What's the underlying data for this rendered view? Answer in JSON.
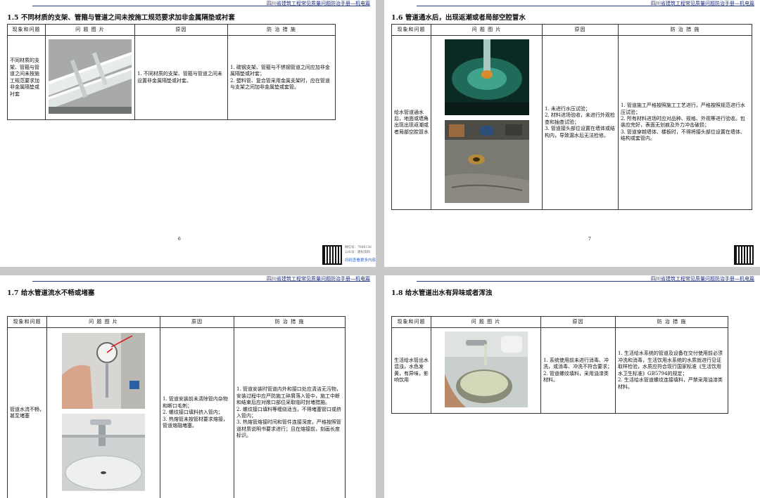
{
  "header": "四川省建筑工程常见质量问题防治手册—机电篇",
  "columns": [
    "现象和问题",
    "问 题 图 片",
    "原因",
    "防 治 措 施"
  ],
  "pages": [
    {
      "title": "1.5 不同材质的支架、管箍与管道之间未按施工规范要求加非金属隔垫或衬套",
      "phenomenon": "不同材质的支架、管箍与管道之间未按施工规范要求加非金属隔垫或衬套",
      "cause": "1. 不同材质的支架、管箍与管道之间未设置非金属隔垫或衬套。",
      "measures": "1. 碳钢支架、管箍与不锈钢管道之间应加非金属隔垫或衬套；\n2. 塑料管、复合管采用金属支架时，应在管道与支架之间加非金属垫或套管。",
      "page_no": "6",
      "qr_line1": "微信号：7886156",
      "qr_line2": "公众号：建标资料",
      "qr_link": "扫码查看更多内容"
    },
    {
      "title": "1.6 管道通水后，出现返潮或者局部空腔冒水",
      "phenomenon": "给水管道通水后，地面或墙角出现出现返潮或者局部空腔冒水",
      "cause": "1. 未进行水压试验；\n2. 材料进场验收，未进行外观检查和抽查试验；\n3. 管道接头部位设置在墙体或结构内，导致漏水后无法检修。",
      "measures": "1. 管道施工严格按照施工工艺进行，严格按照规范进行水压试验；\n2. 所有材料进场时应对品种、规格、外观等进行验收。包装应完好，表面无划痕及外力冲击破损；\n3. 管道穿越墙体、楼板时，不得将接头部位设置在墙体、结构或套管内。",
      "page_no": "7"
    },
    {
      "title": "1.7 给水管道流水不畅或堵塞",
      "phenomenon": "管道水流不畅，甚至堵塞",
      "cause": "1. 管道安装前未清除管内杂物和断口毛刺；\n2. 螺纹接口填料挤入管内；\n3. 热熔管未按管材要求熔接，管道熔融堵塞。",
      "measures": "1. 管道安装时管道内外和接口处应清洁无污物，安装过程中应严防施工碎屑落入管中，施工中断和结束后应对敞口部位采取临时封堵措施。\n2. 螺纹接口填料等缠绕适当，不得堵塞管口或挤入管内；\n3. 热熔管熔接时间和管件连接深度，严格按照管道材质说明书要求进行；且在熔接前，刻画长度标识。"
    },
    {
      "title": "1.8 给水管道出水有异味或者浑浊",
      "phenomenon": "生活给水管出水混浊，水色发黄，有异味，影响饮用",
      "cause": "1. 系统使用前未进行消毒、冲洗，或消毒、冲洗不符合要求；\n2. 管道螺纹填料，采用油漆类材料。",
      "measures": "1. 生活给水系统的管道及设备在交付使用前必须冲洗和消毒，生活饮用水系统的水质就进行见证取样检验，水质应符合现行国家标准《生活饮用水卫生标准》GB5794的规定；\n2. 生活给水管道螺纹连接填料，严禁采用油漆类材料。"
    }
  ]
}
